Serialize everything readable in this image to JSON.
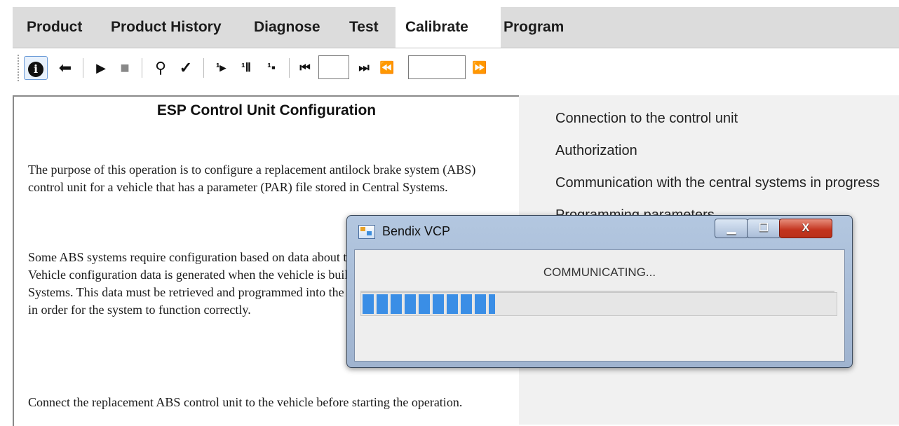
{
  "tabs": [
    {
      "label": "Product",
      "active": false
    },
    {
      "label": "Product History",
      "active": false
    },
    {
      "label": "Diagnose",
      "active": false
    },
    {
      "label": "Test",
      "active": false
    },
    {
      "label": "Calibrate",
      "active": true
    },
    {
      "label": "Program",
      "active": false
    }
  ],
  "toolbar": {
    "info_glyph": "i",
    "back_glyph": "⬅",
    "play_glyph": "▶",
    "stop_glyph": "■",
    "hint_glyph": "⚲",
    "check_glyph": "✓",
    "step1_glyph": "¹▸",
    "step2_glyph": "¹Ⅱ",
    "step3_glyph": "¹▪",
    "first_glyph": "⏮",
    "next_glyph": "⏭",
    "rewind_glyph": "⏪",
    "forward_glyph": "⏩",
    "input1_value": "",
    "input2_value": ""
  },
  "document": {
    "title": "ESP Control Unit Configuration",
    "paragraph1": "The purpose of this operation is to configure a replacement antilock brake system (ABS) control unit for a vehicle that has a parameter (PAR) file stored in Central Systems.",
    "paragraph2": "Some ABS systems require configuration based on data about the vehicle that it is installed in. Vehicle configuration data is generated when the vehicle is built and is stored in the Central Systems. This data must be retrieved and programmed into the replacement ABS control unit in order for the system to function correctly.",
    "paragraph3": "Connect the replacement ABS control unit to the vehicle before starting the operation."
  },
  "steps": [
    "Connection to the control unit",
    "Authorization",
    "Communication with the central systems in progress",
    "Programming parameters"
  ],
  "dialog": {
    "title": "Bendix VCP",
    "message": "COMMUNICATING...",
    "progress_percent": 28,
    "minimize_glyph": "▁",
    "maximize_glyph": "☐",
    "close_glyph": "X"
  }
}
